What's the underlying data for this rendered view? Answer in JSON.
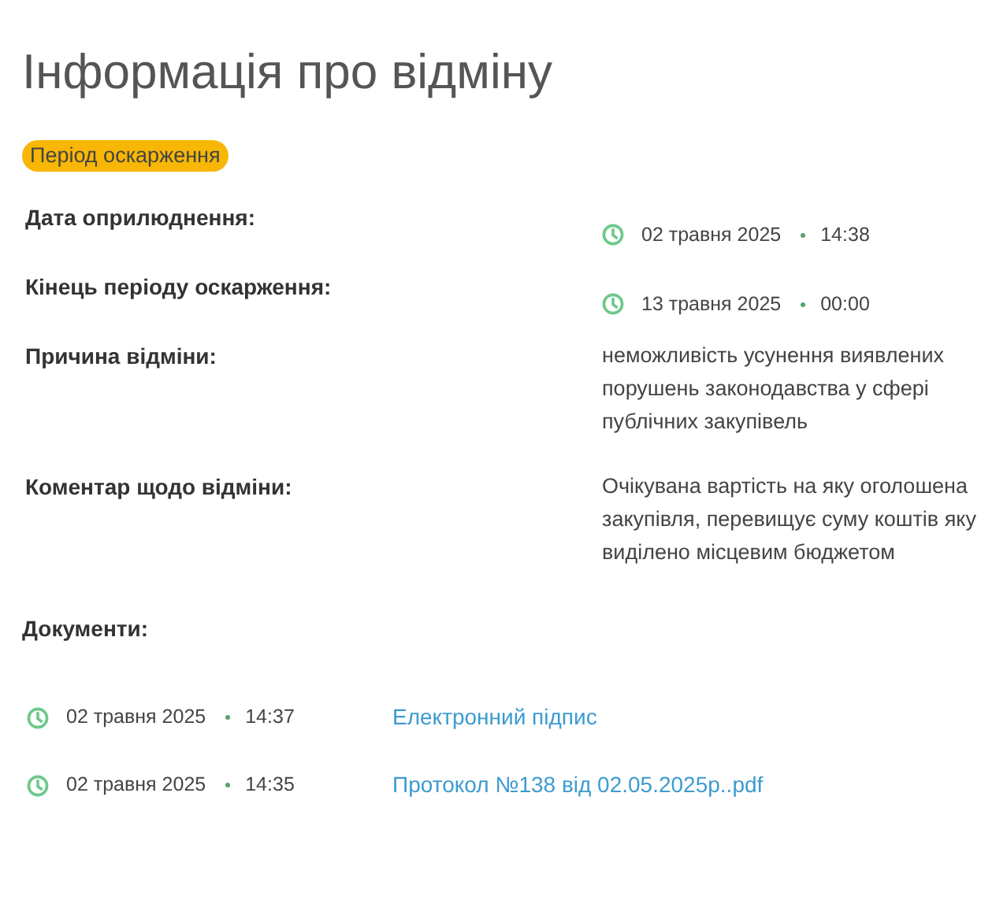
{
  "title": "Інформація про відміну",
  "status_badge": "Період оскарження",
  "fields": [
    {
      "kind": "datetime",
      "label": "Дата оприлюднення:",
      "date": "02 травня 2025",
      "time": "14:38"
    },
    {
      "kind": "datetime",
      "label": "Кінець періоду оскарження:",
      "date": "13 травня 2025",
      "time": "00:00"
    },
    {
      "kind": "text",
      "label": "Причина відміни:",
      "value": "неможливість усунення виявлених порушень законодавства у сфері публічних закупівель"
    },
    {
      "kind": "text",
      "label": "Коментар щодо відміни:",
      "value": "Очікувана вартість на яку оголошена закупівля, перевищує суму коштів яку виділено місцевим бюджетом"
    }
  ],
  "documents": {
    "heading": "Документи:",
    "items": [
      {
        "date": "02 травня 2025",
        "time": "14:37",
        "name": "Електронний підпис"
      },
      {
        "date": "02 травня 2025",
        "time": "14:35",
        "name": "Протокол №138 від 02.05.2025р..pdf"
      }
    ]
  }
}
